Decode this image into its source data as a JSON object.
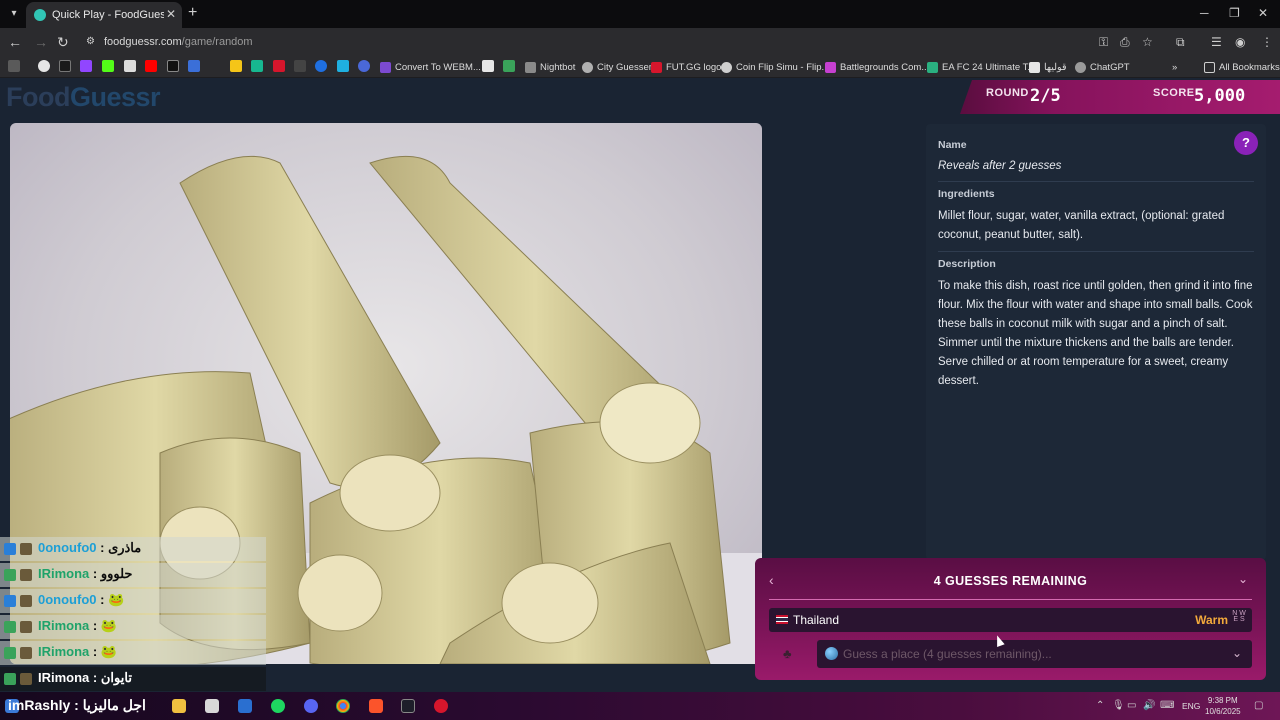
{
  "browser": {
    "tab_title": "Quick Play - FoodGuessr | Food",
    "url_domain": "foodguessr.com",
    "url_path": "/game/random",
    "bookmarks": [
      "Convert To WEBM...",
      "Nightbot",
      "City Guesser",
      "FUT.GG logo",
      "Coin Flip Simu - Flip...",
      "Battlegrounds Com...",
      "EA FC 24 Ultimate T...",
      "قوليها",
      "ChatGPT"
    ],
    "all_bookmarks": "All Bookmarks"
  },
  "header": {
    "logo_part1": "Food",
    "logo_part2": "Guessr",
    "round_label": "ROUND",
    "round_value": "2/5",
    "score_label": "SCORE",
    "score_value": "5,000"
  },
  "info": {
    "name_label": "Name",
    "name_value": "Reveals after 2 guesses",
    "ingredients_label": "Ingredients",
    "ingredients_value": "Millet flour, sugar, water, vanilla extract, (optional: grated coconut, peanut butter, salt).",
    "description_label": "Description",
    "description_value": "To make this dish, roast rice until golden, then grind it into fine flour. Mix the flour with water and shape into small balls. Cook these balls in coconut milk with sugar and a pinch of salt. Simmer until the mixture thickens and the balls are tender. Serve chilled or at room temperature for a sweet, creamy dessert."
  },
  "guess_panel": {
    "title": "4 GUESSES REMAINING",
    "previous_guess": {
      "country": "Thailand",
      "warmth": "Warm"
    },
    "compass": "N W E S",
    "input_placeholder": "Guess a place (4 guesses remaining)..."
  },
  "chat": [
    {
      "user": "0onoufo0",
      "message": "ماذرى",
      "style": "light",
      "color": "blue"
    },
    {
      "user": "IRimona",
      "message": "حلووو",
      "style": "light",
      "color": "green"
    },
    {
      "user": "0onoufo0",
      "message": "🐸",
      "style": "light",
      "color": "blue"
    },
    {
      "user": "IRimona",
      "message": "🐸",
      "style": "light",
      "color": "green"
    },
    {
      "user": "IRimona",
      "message": "🐸",
      "style": "light",
      "color": "green"
    },
    {
      "user": "IRimona",
      "message": "تايوان",
      "style": "dark",
      "color": "white"
    }
  ],
  "taskbar": {
    "overlay_user": "imRashly : اجل ماليزيا",
    "language": "ENG",
    "time": "9:38 PM",
    "date": "10/6/2025"
  },
  "colors": {
    "page_bg": "#1a2433",
    "panel_bg": "#1d2837",
    "accent_magenta": "#a51c6f",
    "warm": "#f2a93b"
  }
}
